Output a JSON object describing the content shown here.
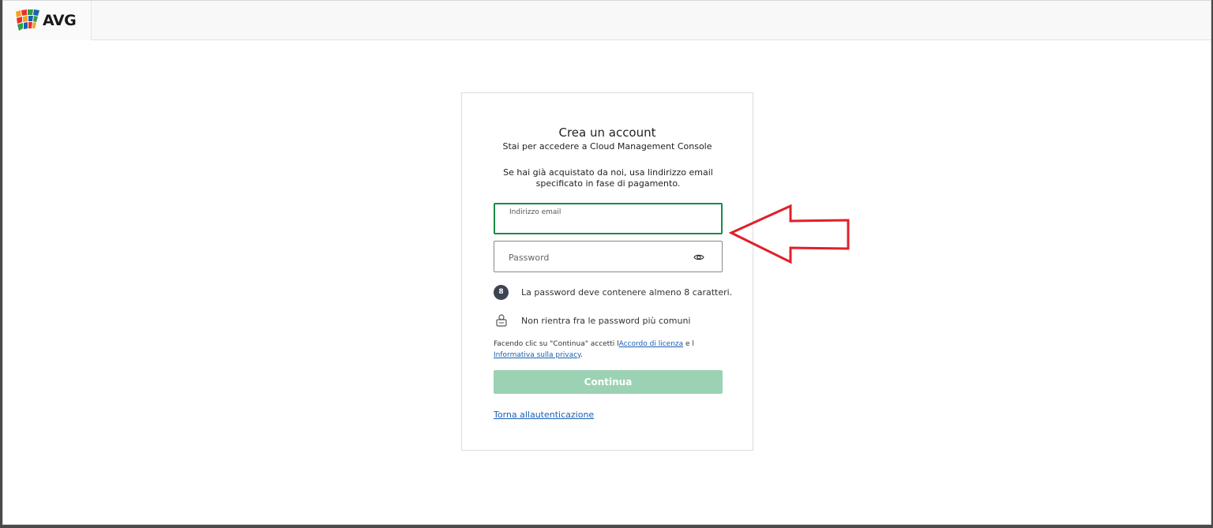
{
  "header": {
    "brand": "AVG",
    "logo_icon": "avg-flag-logo-icon"
  },
  "form": {
    "title": "Crea un account",
    "subtitle": "Stai per accedere a Cloud Management Console",
    "info": "Se hai già acquistato da noi, usa lindirizzo email specificato in fase di pagamento.",
    "email": {
      "label": "Indirizzo email",
      "value": ""
    },
    "password": {
      "placeholder": "Password",
      "icon": "eye-icon"
    },
    "rules": [
      {
        "badge": "8",
        "text": "La password deve contenere almeno 8 caratteri."
      },
      {
        "icon": "lock-icon",
        "text": "Non rientra fra le password più comuni"
      }
    ],
    "terms": {
      "prefix": "Facendo clic su \"Continua\" accetti l",
      "license_link": "Accordo di licenza",
      "middle": " e l",
      "privacy_link": "Informativa sulla privacy",
      "suffix": "."
    },
    "continue_label": "Continua",
    "back_link": "Torna allautenticazione"
  },
  "colors": {
    "accent_green": "#1a8a46",
    "button_disabled": "#9bd2b4",
    "link_blue": "#1a5fb4",
    "annotation_red": "#e0202a"
  },
  "annotation": {
    "icon": "red-arrow-left-icon"
  }
}
